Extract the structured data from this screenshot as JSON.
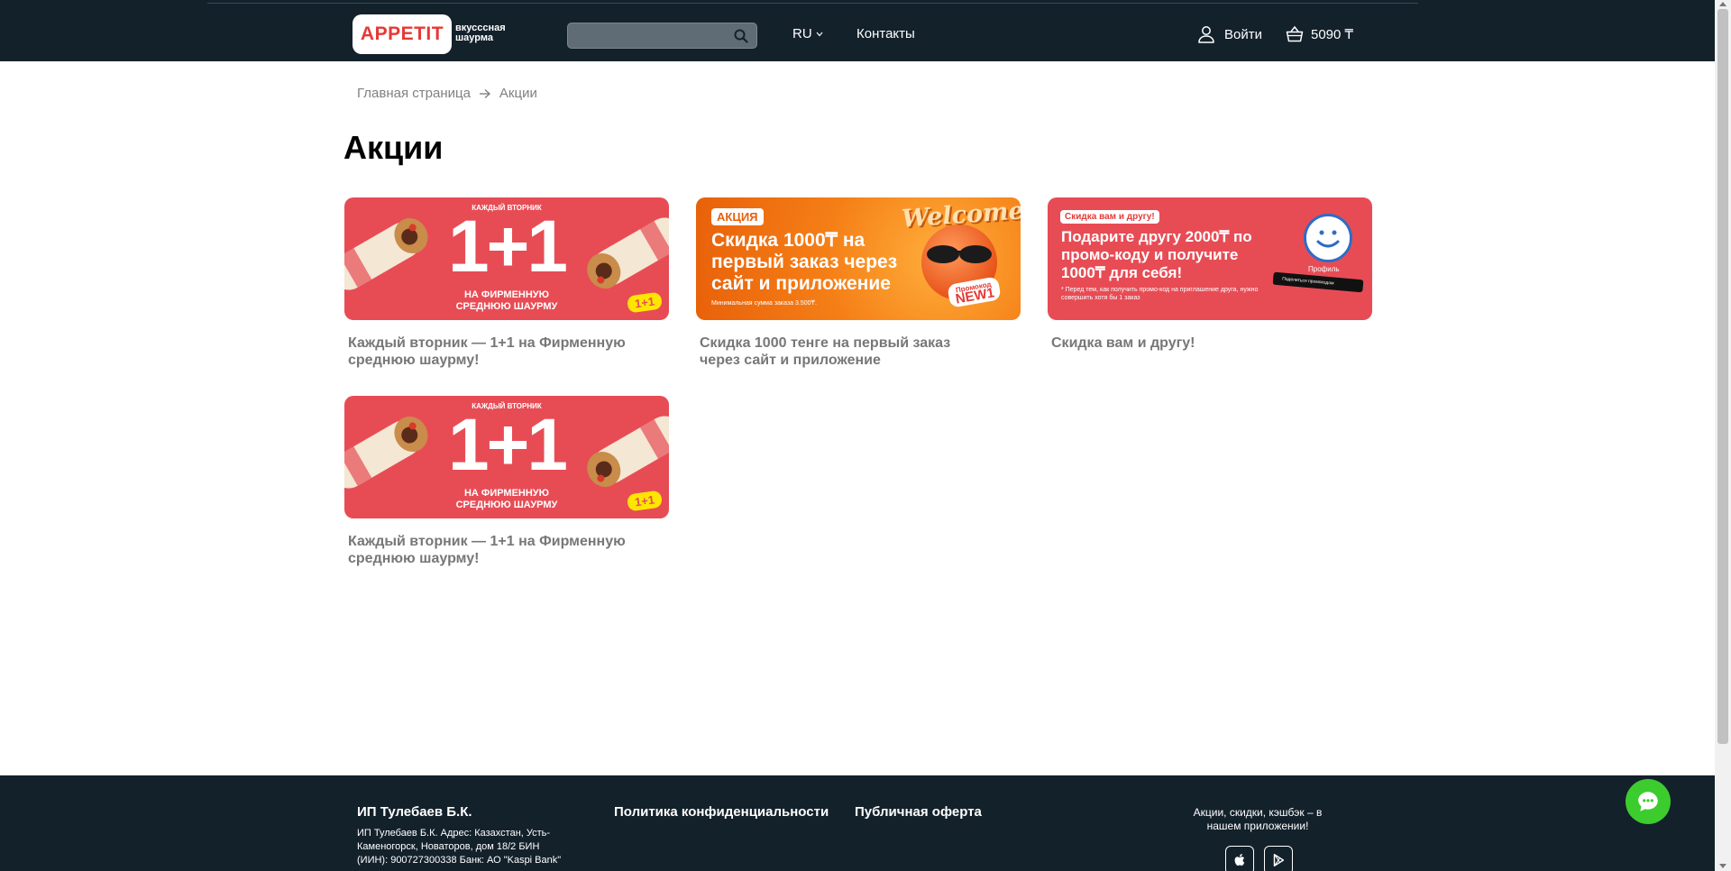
{
  "header": {
    "logo_text": "APPETIT",
    "logo_subtitle": "вкусссная шаурма",
    "search_placeholder": "",
    "language": "RU",
    "contacts": "Контакты",
    "login": "Войти",
    "cart_total": "5090 ₸"
  },
  "breadcrumb": {
    "home": "Главная страница",
    "current": "Акции"
  },
  "page_title": "Акции",
  "promos": [
    {
      "title": "Каждый вторник — 1+1 на Фирменную среднюю шаурму!",
      "banner": {
        "week": "КАЖДЫЙ ВТОРНИК",
        "big": "1+1",
        "line1": "НА ФИРМЕННУЮ",
        "line2": "СРЕДНЮЮ ШАУРМУ",
        "tag": "1+1"
      }
    },
    {
      "title": "Скидка 1000 тенге на первый заказ через сайт и приложение",
      "banner": {
        "badge": "АКЦИЯ",
        "headline": "Скидка 1000₸ на первый заказ через сайт и приложение",
        "min": "Минимальная сумма заказа 3.500₸.",
        "welcome": "Welcome",
        "code_label": "Промокод",
        "code": "NEW1"
      }
    },
    {
      "title": "Скидка вам и другу!",
      "banner": {
        "badge": "Скидка вам и другу!",
        "headline": "Подарите другу 2000₸ по промо-коду и получите 1000₸ для себя!",
        "note": "* Перед тем, как получить промо-код на приглашение друга, нужно совершить хотя бы 1 заказ",
        "profile": "Профиль",
        "share": "Поделиться промокодом"
      }
    },
    {
      "title": "Каждый вторник — 1+1 на Фирменную среднюю шаурму!",
      "banner": {
        "week": "КАЖДЫЙ ВТОРНИК",
        "big": "1+1",
        "line1": "НА ФИРМЕННУЮ",
        "line2": "СРЕДНЮЮ ШАУРМУ",
        "tag": "1+1"
      }
    }
  ],
  "footer": {
    "company": "ИП Тулебаев Б.К.",
    "address": "ИП Тулебаев Б.К. Адрес: Казахстан, Усть-Каменогорск, Новаторов, дом 18/2 БИН (ИИН): 900727300338 Банк: АО \"Kaspi Bank\"",
    "privacy": "Политика конфиденциальности",
    "offer": "Публичная оферта",
    "app_promo": "Акции, скидки, кэшбэк – в нашем приложении!"
  },
  "colors": {
    "header_bg": "#13212b",
    "brand_red": "#e53935",
    "chat_green": "#3ccc2e"
  },
  "icons": [
    "search-icon",
    "chevron-down-icon",
    "user-icon",
    "basket-icon",
    "arrow-right-icon",
    "apple-icon",
    "google-play-icon",
    "chat-icon"
  ]
}
